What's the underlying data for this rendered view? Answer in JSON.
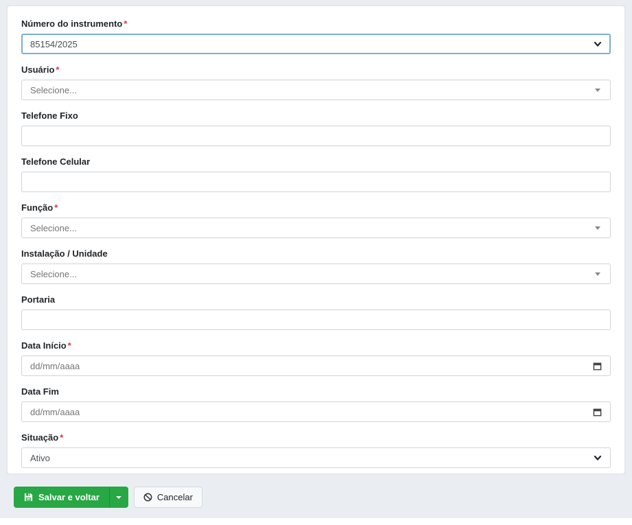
{
  "form": {
    "required_marker": "*",
    "fields": [
      {
        "label": "Número do instrumento",
        "required": true,
        "type": "select-native",
        "value": "85154/2025",
        "focused": true
      },
      {
        "label": "Usuário",
        "required": true,
        "type": "select2",
        "value": "Selecione..."
      },
      {
        "label": "Telefone Fixo",
        "required": false,
        "type": "text",
        "value": ""
      },
      {
        "label": "Telefone Celular",
        "required": false,
        "type": "text",
        "value": ""
      },
      {
        "label": "Função",
        "required": true,
        "type": "select2",
        "value": "Selecione..."
      },
      {
        "label": "Instalação / Unidade",
        "required": false,
        "type": "select2",
        "value": "Selecione..."
      },
      {
        "label": "Portaria",
        "required": false,
        "type": "text",
        "value": ""
      },
      {
        "label": "Data Início",
        "required": true,
        "type": "date",
        "placeholder": "dd/mm/aaaa"
      },
      {
        "label": "Data Fim",
        "required": false,
        "type": "date",
        "placeholder": "dd/mm/aaaa"
      },
      {
        "label": "Situação",
        "required": true,
        "type": "select-native",
        "value": "Ativo"
      }
    ]
  },
  "actions": {
    "save_label": "Salvar e voltar",
    "cancel_label": "Cancelar"
  },
  "icons": {
    "save": "floppy-disk-icon",
    "save_dropdown": "caret-down-icon",
    "cancel": "ban-icon",
    "native_select": "chevron-down-icon",
    "select2": "triangle-down-icon",
    "date": "calendar-icon"
  },
  "colors": {
    "page_background": "#eaeef2",
    "card_background": "#ffffff",
    "primary_green": "#28a745",
    "required_red": "#dc3545",
    "focus_border_blue": "#79aed7",
    "input_border": "#ced4da",
    "placeholder_gray": "#757575"
  }
}
